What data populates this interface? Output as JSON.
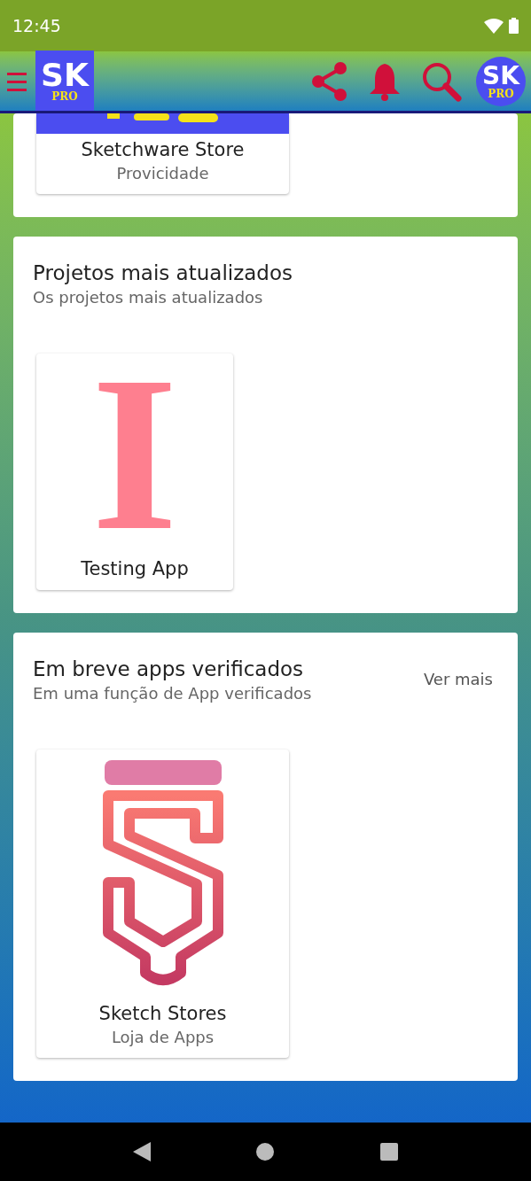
{
  "status_bar": {
    "time": "12:45"
  },
  "app_bar": {
    "logo": {
      "title": "SK",
      "subtitle": "PRO"
    },
    "avatar": {
      "title": "SK",
      "subtitle": "PRO"
    }
  },
  "sections": [
    {
      "items": [
        {
          "kind": "picture",
          "name": "Sketchware Store",
          "category": "Provicidade"
        }
      ]
    },
    {
      "title": "Projetos mais atualizados",
      "subtitle": "Os projetos mais atualizados",
      "items": [
        {
          "kind": "letter",
          "letter": "I",
          "name": "Testing App"
        }
      ]
    },
    {
      "title": "Em breve apps verificados",
      "subtitle": "Em uma função de App verificados",
      "action": "Ver mais",
      "items": [
        {
          "kind": "logo",
          "name": "Sketch Stores",
          "category": "Loja de Apps"
        }
      ]
    }
  ]
}
